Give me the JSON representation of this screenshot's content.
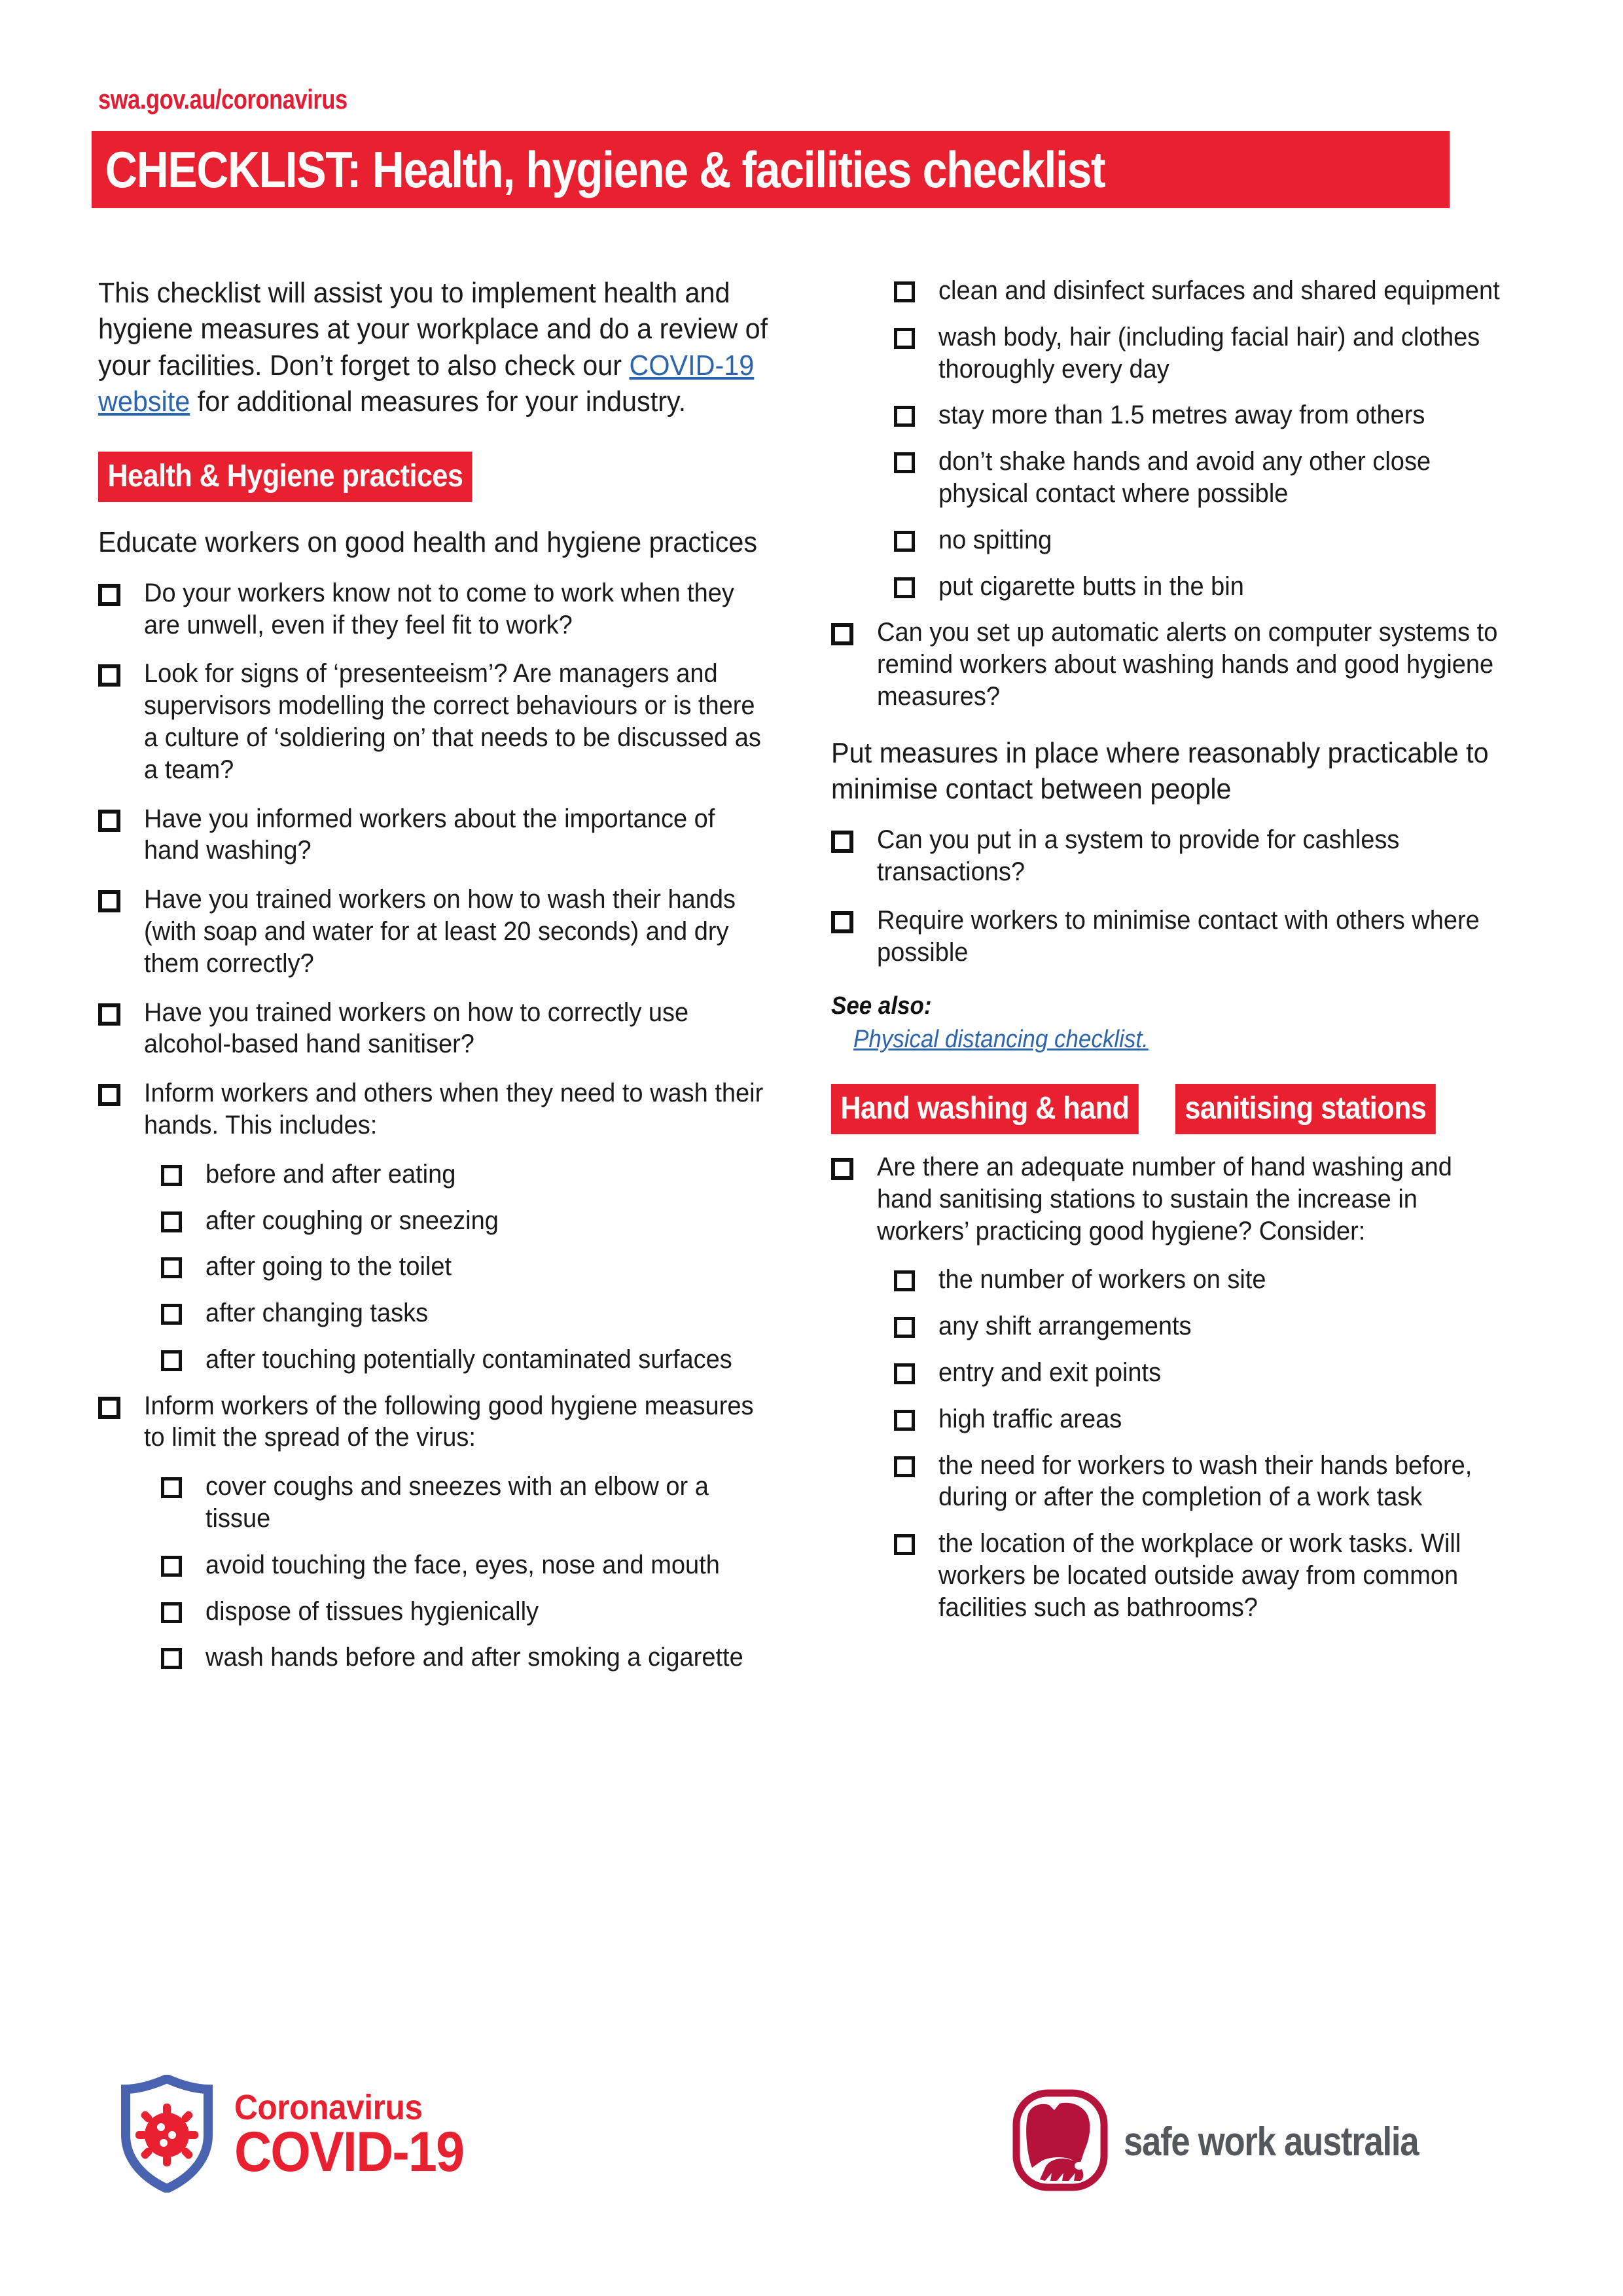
{
  "header": {
    "kicker": "swa.gov.au/coronavirus",
    "title": "CHECKLIST: Health, hygiene & facilities checklist",
    "band_color": "#e8202f"
  },
  "intro": {
    "part1": "This checklist will assist you to implement health and hygiene measures at your workplace and do a review of your facilities. Don’t forget to also check our ",
    "link": "COVID-19 website",
    "part2": " for additional measures for your industry.",
    "link_color": "#2c65ad"
  },
  "sections": {
    "health_hygiene": {
      "band": "Health & Hygiene practices",
      "subhead": "Educate workers on good health and hygiene practices",
      "items": [
        {
          "level": 1,
          "text": "Do your workers know not to come to work when they are unwell, even if they feel fit to work?"
        },
        {
          "level": 1,
          "text": "Look for signs of ‘presenteeism’? Are managers and supervisors modelling the correct behaviours or is there a culture of ‘soldiering on’ that needs to be discussed as a team?"
        },
        {
          "level": 1,
          "text": "Have you informed workers about the importance of hand washing?"
        },
        {
          "level": 1,
          "text": "Have you trained workers on how to wash their hands (with soap and water for at least 20 seconds) and dry them correctly?"
        },
        {
          "level": 1,
          "text": "Have you trained workers on how to correctly use alcohol-based hand sanitiser?"
        },
        {
          "level": 1,
          "text": "Inform workers and others when they need to wash their hands. This includes:"
        },
        {
          "level": 2,
          "text": "before and after eating"
        },
        {
          "level": 2,
          "text": "after coughing or sneezing"
        },
        {
          "level": 2,
          "text": "after going to the toilet"
        },
        {
          "level": 2,
          "text": "after changing tasks"
        },
        {
          "level": 2,
          "text": "after touching potentially contaminated surfaces"
        },
        {
          "level": 1,
          "text": "Inform workers of the following good hygiene measures to limit the spread of the virus:"
        },
        {
          "level": 2,
          "text": "cover coughs and sneezes with an elbow or a tissue"
        },
        {
          "level": 2,
          "text": "avoid touching the face, eyes, nose and mouth"
        },
        {
          "level": 2,
          "text": "dispose of tissues hygienically"
        },
        {
          "level": 2,
          "text": "wash hands before and after smoking a cigarette"
        }
      ]
    },
    "health_hygiene_continued": {
      "items": [
        {
          "level": 2,
          "text": "clean and disinfect surfaces and shared equipment"
        },
        {
          "level": 2,
          "text": "wash body, hair (including facial hair) and clothes thoroughly every day"
        },
        {
          "level": 2,
          "text": "stay more than 1.5 metres away from others"
        },
        {
          "level": 2,
          "text": "don’t shake hands and avoid any other close physical contact where possible"
        },
        {
          "level": 2,
          "text": "no spitting"
        },
        {
          "level": 2,
          "text": "put cigarette butts in the bin"
        },
        {
          "level": 1,
          "text": "Can you set up automatic alerts on computer systems to remind workers about washing hands and good hygiene measures?"
        }
      ]
    },
    "minimise_contact": {
      "subhead": "Put measures in place where reasonably practicable to minimise contact between people",
      "items": [
        {
          "level": 1,
          "text": "Can you put in a system to provide for cashless transactions?"
        },
        {
          "level": 1,
          "text": "Require workers to minimise contact with others where possible"
        }
      ],
      "see_also_label": "See also:",
      "see_also_link": "Physical distancing checklist."
    },
    "hand_washing": {
      "band_line1": "Hand washing & hand",
      "band_line2": "sanitising stations",
      "items": [
        {
          "level": 1,
          "text": "Are there an adequate number of hand washing and hand sanitising stations to sustain the increase in workers’ practicing good hygiene? Consider:"
        },
        {
          "level": 2,
          "text": "the number of workers on site"
        },
        {
          "level": 2,
          "text": "any shift arrangements"
        },
        {
          "level": 2,
          "text": "entry and exit points"
        },
        {
          "level": 2,
          "text": "high traffic areas"
        },
        {
          "level": 2,
          "text": "the need for workers to wash their hands before, during or after the completion of a work task"
        },
        {
          "level": 2,
          "text": "the location of the workplace or work tasks. Will workers be located outside away from common facilities such as bathrooms?"
        }
      ]
    }
  },
  "footer": {
    "covid_logo": {
      "line1": "Coronavirus",
      "line2": "COVID-19",
      "color": "#e8202f",
      "shield_color": "#4a63b0"
    },
    "swa_logo": {
      "text": "safe work australia",
      "mark_color": "#b5123c",
      "text_color": "#54575c"
    }
  }
}
